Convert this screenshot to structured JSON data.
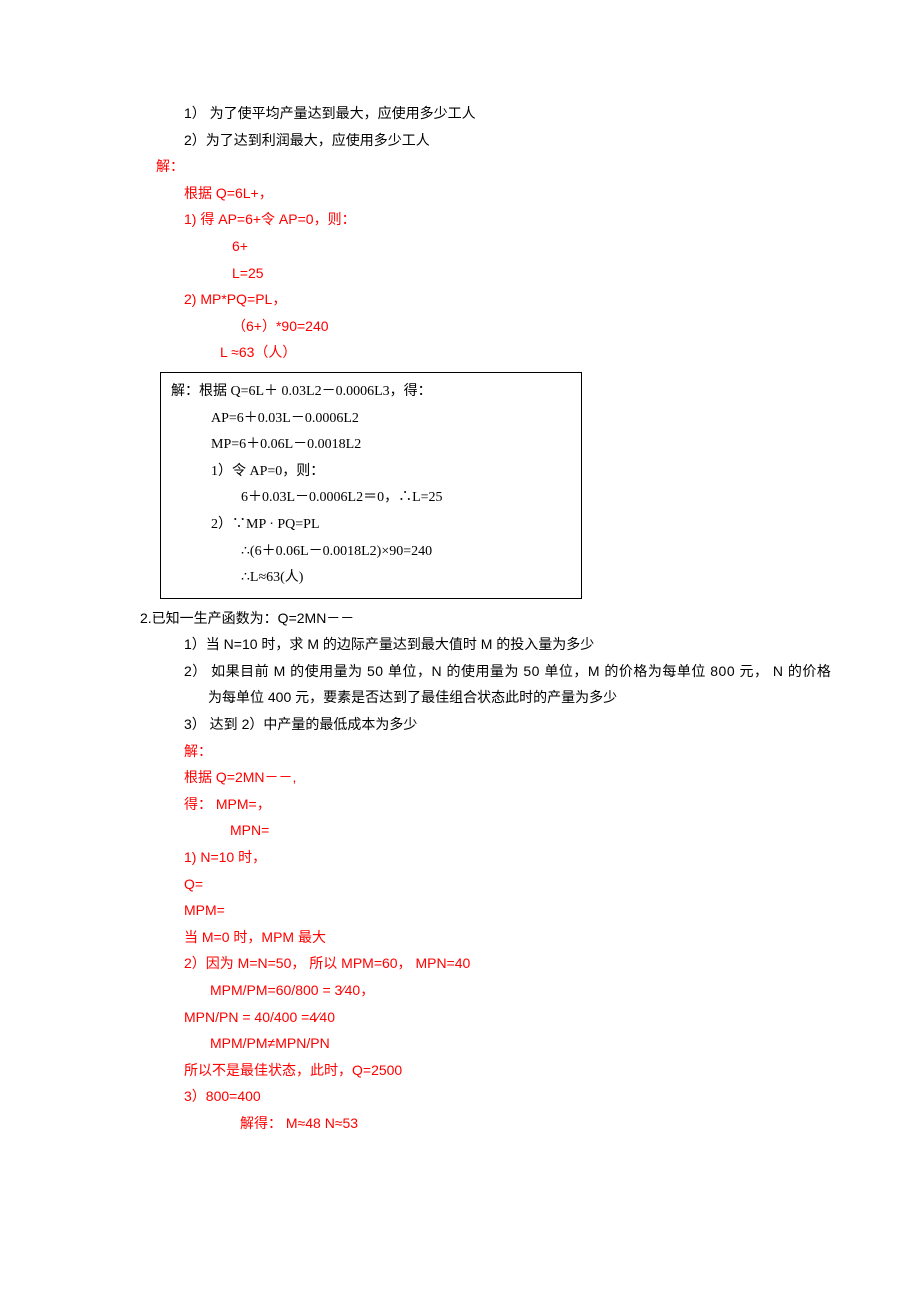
{
  "p1": {
    "q1": "1） 为了使平均产量达到最大，应使用多少工人",
    "q2": "2）为了达到利润最大，应使用多少工人",
    "sol_label": "解：",
    "l1": "根据 Q=6L+，",
    "l2": " 1)   得   AP=6+令 AP=0，则：",
    "l3": "6+",
    "l4": "L=25",
    "l5": " 2)   MP*PQ=PL，",
    "l6": "（6+）*90=240",
    "l7": "L ≈63（人）"
  },
  "box": {
    "b1": "解：根据 Q=6L＋ 0.03L2－0.0006L3，得：",
    "b2": "AP=6＋0.03L－0.0006L2",
    "b3": "MP=6＋0.06L－0.0018L2",
    "b4": "1）令 AP=0，则：",
    "b5": "6＋0.03L－0.0006L2＝0，∴L=25",
    "b6": "2）∵MP · PQ=PL",
    "b7": "∴(6＋0.06L－0.0018L2)×90=240",
    "b8": "∴L≈63(人)"
  },
  "p2": {
    "head": "2.已知一生产函数为：Q=2MN－－",
    "q1": "1）当 N=10 时，求 M 的边际产量达到最大值时 M 的投入量为多少",
    "q2a": "2）  如果目前 M 的使用量为 50 单位，N 的使用量为 50 单位，M 的价格为每单位 800 元，  N 的价格",
    "q2b": "为每单位 400 元，要素是否达到了最佳组合状态此时的产量为多少",
    "q3": "3）  达到 2）中产量的最低成本为多少",
    "sol_label": "解：",
    "l1": "根据 Q=2MN－－,",
    "l2": "得：  MPM=，",
    "l3": "MPN=",
    "l4": "1)      N=10 时，",
    "l5": "Q=",
    "l6": "MPM=",
    "l7": "当 M=0 时，MPM 最大",
    "l8": "2）因为 M=N=50，  所以  MPM=60，  MPN=40",
    "l9": "MPM/PM=60/800 = 3⁄40，",
    "l10": "MPN/PN = 40/400 =4⁄40",
    "l11": "MPM/PM≠MPN/PN",
    "l12": "所以不是最佳状态，此时，Q=2500",
    "l13": "3）800=400",
    "l14": "解得：  M≈48           N≈53"
  }
}
